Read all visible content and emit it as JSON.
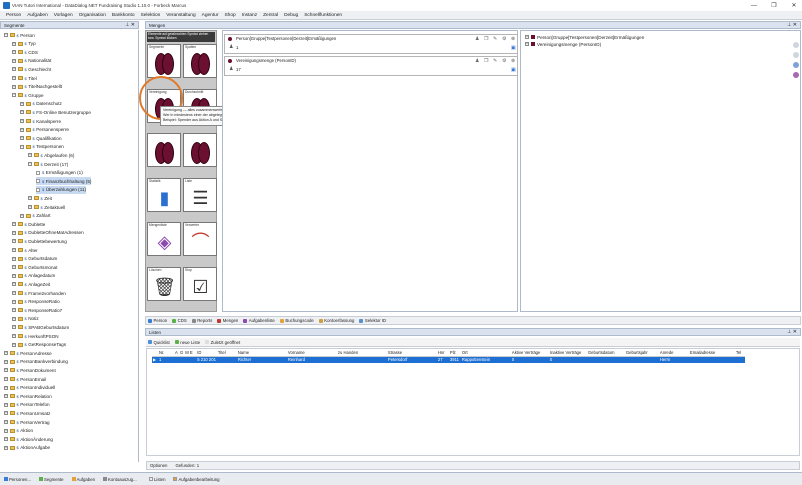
{
  "window": {
    "title": "VIAN Tutori International - DataDialog.NET Fundraising Studio 1.10.0 - Forbeck Marcus"
  },
  "menu": [
    "Person",
    "Aufgaben",
    "Vorlagen",
    "Organisation",
    "Bankkonto",
    "Selektion",
    "Veranstaltung",
    "Agentur",
    "Shop",
    "Instanz",
    "Zentral",
    "Debug",
    "Schnellfunktionen"
  ],
  "left_panel": {
    "title": "Segmente",
    "pin": "⊥ ✕"
  },
  "mengen_panel": {
    "title": "Mengen",
    "pin": "⊥ ✕"
  },
  "tree": [
    {
      "label": "Person",
      "indent": 0,
      "type": "expanded"
    },
    {
      "label": "Typ",
      "indent": 1,
      "type": "folder"
    },
    {
      "label": "CDS",
      "indent": 1,
      "type": "folder"
    },
    {
      "label": "Nationalität",
      "indent": 1,
      "type": "folder"
    },
    {
      "label": "Geschlecht",
      "indent": 1,
      "type": "folder"
    },
    {
      "label": "Titel",
      "indent": 1,
      "type": "folder"
    },
    {
      "label": "TitelNachgestellt",
      "indent": 1,
      "type": "folder"
    },
    {
      "label": "Gruppe",
      "indent": 1,
      "type": "expanded"
    },
    {
      "label": "Datenschutz",
      "indent": 2,
      "type": "folder"
    },
    {
      "label": "FS-Online Benutzergruppe",
      "indent": 2,
      "type": "folder"
    },
    {
      "label": "Kanalsperre",
      "indent": 2,
      "type": "folder"
    },
    {
      "label": "Personensperre",
      "indent": 2,
      "type": "folder"
    },
    {
      "label": "Qualifikation",
      "indent": 2,
      "type": "folder"
    },
    {
      "label": "Testpersonen",
      "indent": 2,
      "type": "expanded"
    },
    {
      "label": "Abgelaufen (6)",
      "indent": 3,
      "type": "folder"
    },
    {
      "label": "Derzeit (17)",
      "indent": 3,
      "type": "expanded"
    },
    {
      "label": "Ermäßigungen (1)",
      "indent": 4,
      "type": "file"
    },
    {
      "label": "Finanzbuchhaltung (5)",
      "indent": 4,
      "type": "file",
      "selected": true
    },
    {
      "label": "Überzahlungen (11)",
      "indent": 4,
      "type": "file",
      "selected": true
    },
    {
      "label": "Zeit",
      "indent": 3,
      "type": "folder"
    },
    {
      "label": "Zeitaktuell",
      "indent": 3,
      "type": "folder"
    },
    {
      "label": "Zahlart",
      "indent": 2,
      "type": "folder"
    },
    {
      "label": "Dublette",
      "indent": 1,
      "type": "folder"
    },
    {
      "label": "DubletteOhneMatAdressen",
      "indent": 1,
      "type": "folder"
    },
    {
      "label": "Dublettebewertung",
      "indent": 1,
      "type": "folder"
    },
    {
      "label": "Alter",
      "indent": 1,
      "type": "folder"
    },
    {
      "label": "Geburtsdatum",
      "indent": 1,
      "type": "folder"
    },
    {
      "label": "Geburtsmonat",
      "indent": 1,
      "type": "folder"
    },
    {
      "label": "Anlagedatum",
      "indent": 1,
      "type": "folder"
    },
    {
      "label": "AnlageZeit",
      "indent": 1,
      "type": "folder"
    },
    {
      "label": "Frame2vorhanden",
      "indent": 1,
      "type": "folder"
    },
    {
      "label": "ResponseRatio",
      "indent": 1,
      "type": "folder"
    },
    {
      "label": "ResponseRatio7",
      "indent": 1,
      "type": "folder"
    },
    {
      "label": "Notiz",
      "indent": 1,
      "type": "folder"
    },
    {
      "label": "SPABGeburtsdatum",
      "indent": 1,
      "type": "folder"
    },
    {
      "label": "HerkunftPSON",
      "indent": 1,
      "type": "folder"
    },
    {
      "label": "GetResponseTags",
      "indent": 1,
      "type": "folder"
    },
    {
      "label": "PersonAdresse",
      "indent": 0,
      "type": "folder"
    },
    {
      "label": "PersonBankverbindung",
      "indent": 0,
      "type": "folder"
    },
    {
      "label": "PersonDokument",
      "indent": 0,
      "type": "folder"
    },
    {
      "label": "PersonEmail",
      "indent": 0,
      "type": "folder"
    },
    {
      "label": "PersonIndividuell",
      "indent": 0,
      "type": "folder"
    },
    {
      "label": "PersonRelation",
      "indent": 0,
      "type": "folder"
    },
    {
      "label": "PersonTelefon",
      "indent": 0,
      "type": "folder"
    },
    {
      "label": "PersonUmsatz",
      "indent": 0,
      "type": "folder"
    },
    {
      "label": "PersonVertrag",
      "indent": 0,
      "type": "folder"
    },
    {
      "label": "Aktion",
      "indent": 0,
      "type": "folder"
    },
    {
      "label": "AktionÄnderung",
      "indent": 0,
      "type": "folder"
    },
    {
      "label": "AktionAufgabe",
      "indent": 0,
      "type": "folder"
    }
  ],
  "toolbox": {
    "header": "Elemente auf gewünschten Symbol ziehen bzw. Symbol klicken",
    "tools": [
      {
        "label": "Segmente"
      },
      {
        "label": "Spalten"
      },
      {
        "label": "Vereinigung"
      },
      {
        "label": "Durchschnitt"
      },
      {
        "label": ""
      },
      {
        "label": ""
      },
      {
        "label": "Statistik"
      },
      {
        "label": "Liste"
      },
      {
        "label": "Mengenliste"
      },
      {
        "label": "Verwerter"
      },
      {
        "label": "Löschen"
      },
      {
        "label": "Stop"
      }
    ]
  },
  "tooltip": {
    "line1": "Vereinigung — alles zusammenwerfen.",
    "line2": "Wer in mindestens einer der abgelegten Mengen vorkommt, ist danach dabei.",
    "line3": "Beispiel: Spender aus Aktion A und Spender aus Aktion B ergibt alle, die bei mindestens einer der beiden dabei waren."
  },
  "sets": [
    {
      "title": "Person[Gruppe[Testpersonen[Derzeit[Ermäßigungen",
      "count": "1"
    },
    {
      "title": "Vereinigungsmenge (PersonID)",
      "count": "17"
    }
  ],
  "right_tree": [
    "Person[Gruppe[Testpersonen[Derzeit[Ermäßigungen",
    "Vereinigungsmenge (PersonID)"
  ],
  "mid_tabs": [
    "Person",
    "CDS",
    "Reports",
    "Mengen",
    "Aufgabenliste",
    "Buchungscode",
    "Kontoerfassung",
    "Selektor ID"
  ],
  "liste": {
    "title": "Listen",
    "subtabs": [
      "Quicklist",
      "neue Liste",
      "Zuletzt geöffnet"
    ],
    "columns": [
      "",
      "Nr.",
      "A",
      "G",
      "M E",
      "ID",
      "Titel",
      "Name",
      "Vorname",
      "zu Handen",
      "Strasse",
      "Hnr",
      "Plz",
      "Ort",
      "Aktive Verträge",
      "Inaktive Verträge",
      "Geburtsdatum",
      "Geburtsjahr",
      "Anrede",
      "Emailadresse",
      "Tel"
    ],
    "rows": [
      [
        "▶",
        "1",
        "",
        "",
        "",
        "5 210 201",
        "",
        "Richter",
        "Reinhard",
        "",
        "Petersdorf",
        "27",
        "3911",
        "Rappottenstein",
        "0",
        "0",
        "",
        "",
        "Herrn",
        "",
        ""
      ]
    ],
    "footer": {
      "options": "Optionen",
      "found": "Gefunden: 1"
    }
  },
  "bottom_tabs_left": [
    "Personen...",
    "Segmente",
    "Aufgaben",
    "Kontoauszug..."
  ],
  "bottom_tabs_right": [
    "Listen",
    "Aufgabenbearbeitung"
  ],
  "colors": {
    "accent": "#1f6fc1",
    "panel_header": "#d9e2ee",
    "selection": "#1d6fd3",
    "venn": "#6b1030",
    "highlight_circle": "#e07a2a"
  }
}
